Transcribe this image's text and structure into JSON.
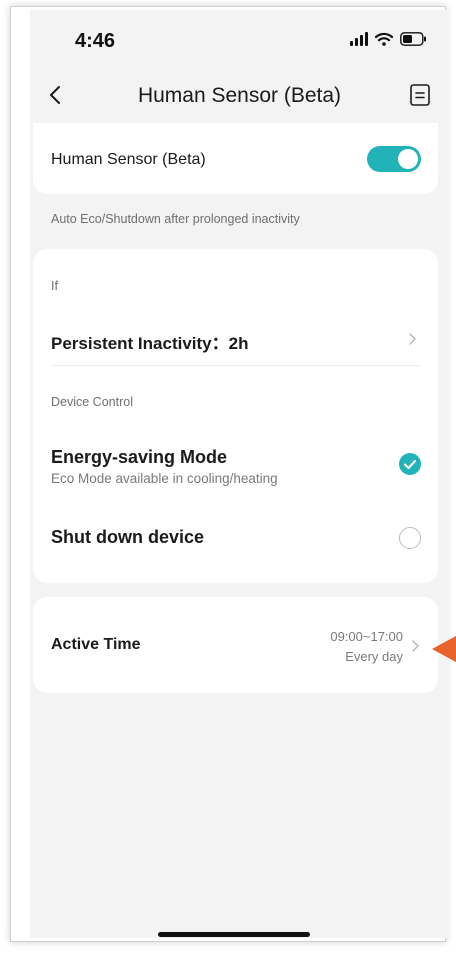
{
  "status_bar": {
    "time": "4:46",
    "icons": [
      "signal-icon",
      "wifi-icon",
      "battery-icon"
    ]
  },
  "nav": {
    "title": "Human Sensor (Beta)",
    "back_icon": "chevron-left-icon",
    "doc_icon": "document-icon"
  },
  "sensor": {
    "label": "Human Sensor (Beta)",
    "enabled": true,
    "hint": "Auto Eco/Shutdown after prolonged inactivity"
  },
  "rules": {
    "if_label": "If",
    "inactivity_text": "Persistent Inactivity：2h",
    "device_control_label": "Device Control",
    "options": [
      {
        "title": "Energy-saving Mode",
        "subtitle": "Eco Mode available in cooling/heating",
        "selected": true
      },
      {
        "title": "Shut down device",
        "subtitle": "",
        "selected": false
      }
    ]
  },
  "active_time": {
    "label": "Active Time",
    "time_range": "09:00~17:00",
    "repeat": "Every day"
  },
  "colors": {
    "accent": "#21b3b8",
    "annotation_arrow": "#e8622c",
    "background": "#f3f3f3",
    "card": "#ffffff"
  }
}
